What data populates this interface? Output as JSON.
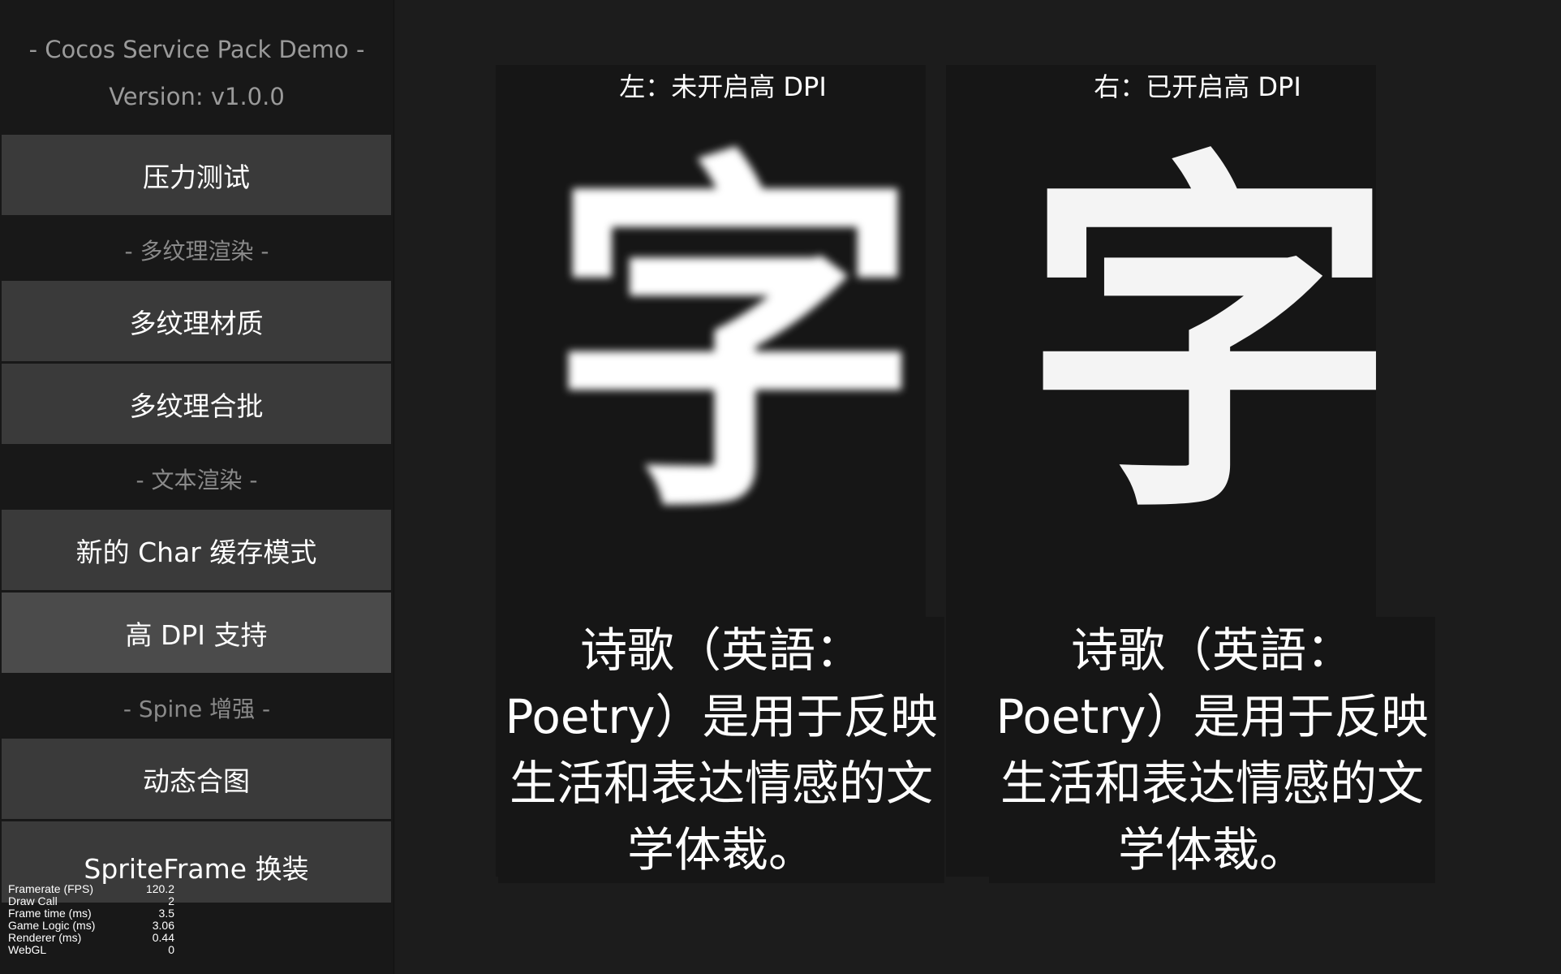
{
  "sidebar": {
    "title": "- Cocos Service Pack Demo -",
    "version": "Version: v1.0.0",
    "buttons": {
      "stress_test": "压力测试",
      "multi_texture_material": "多纹理材质",
      "multi_texture_batch": "多纹理合批",
      "char_cache_mode": "新的 Char 缓存模式",
      "high_dpi": "高 DPI 支持",
      "dynamic_atlas": "动态合图",
      "spriteframe_swap": "SpriteFrame 换装"
    },
    "sections": {
      "multi_texture": "- 多纹理渲染 -",
      "text_render": "- 文本渲染 -",
      "spine": "- Spine 增强 -"
    },
    "active_button": "high_dpi"
  },
  "stats": {
    "rows": [
      {
        "label": "Framerate (FPS)",
        "value": "120.2"
      },
      {
        "label": "Draw Call",
        "value": "2"
      },
      {
        "label": "Frame time (ms)",
        "value": "3.5"
      },
      {
        "label": "Game Logic (ms)",
        "value": "3.06"
      },
      {
        "label": "Renderer (ms)",
        "value": "0.44"
      },
      {
        "label": "WebGL",
        "value": "0"
      }
    ]
  },
  "main": {
    "left": {
      "label": "左：未开启高 DPI",
      "char": "字",
      "poem": "诗歌（英語：Poetry）是用于反映生活和表达情感的文学体裁。"
    },
    "right": {
      "label": "右：已开启高 DPI",
      "char": "字",
      "poem": "诗歌（英語：Poetry）是用于反映生活和表达情感的文学体裁。"
    }
  }
}
